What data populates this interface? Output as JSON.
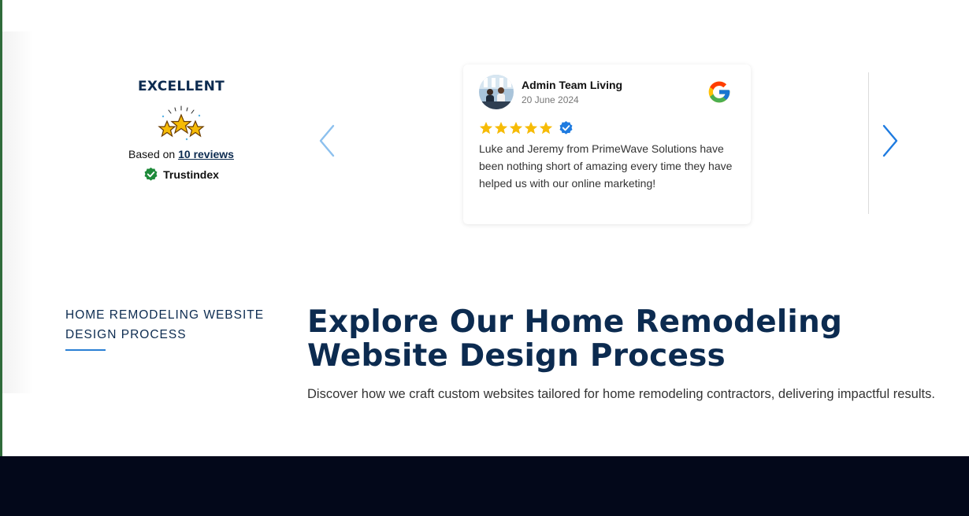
{
  "summary": {
    "rating_label": "EXCELLENT",
    "based_on_prefix": "Based on",
    "reviews_link": "10 reviews",
    "trust_brand": "Trustindex"
  },
  "carousel": {
    "prev_icon": "chevron-left-icon",
    "next_icon": "chevron-right-icon",
    "arrow_color": "#1e7be0"
  },
  "review": {
    "reviewer_name": "Admin Team Living",
    "date": "20 June 2024",
    "source_icon": "google-icon",
    "rating": 5,
    "verified_icon": "verified-badge-icon",
    "text": "Luke and Jeremy from PrimeWave Solutions have been nothing short of amazing every time they have helped us with our online marketing!"
  },
  "process": {
    "label": "HOME REMODELING WEBSITE DESIGN PROCESS",
    "title": "Explore Our Home Remodeling Website Design Process",
    "description": "Discover how we craft custom websites tailored for home remodeling contractors, delivering impactful results."
  },
  "colors": {
    "navy": "#0c2b50",
    "star_gold": "#f6bb06",
    "accent_blue": "#2a7fd4",
    "dark_band": "#03081a"
  }
}
